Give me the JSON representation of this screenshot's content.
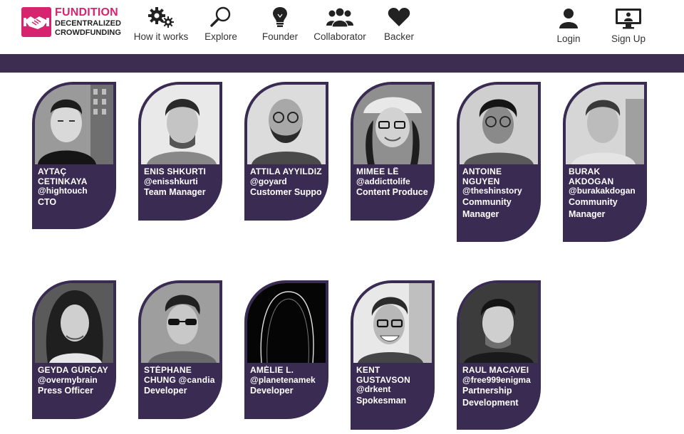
{
  "brand": {
    "title": "FUNDITION",
    "line1": "DECENTRALIZED",
    "line2": "CROWDFUNDING",
    "color": "#d6246e"
  },
  "nav": [
    {
      "label": "How it works",
      "icon": "gears-icon"
    },
    {
      "label": "Explore",
      "icon": "magnifier-icon"
    },
    {
      "label": "Founder",
      "icon": "lightbulb-icon"
    },
    {
      "label": "Collaborator",
      "icon": "group-icon"
    },
    {
      "label": "Backer",
      "icon": "heart-icon"
    }
  ],
  "auth": {
    "login": "Login",
    "signup": "Sign Up"
  },
  "team": [
    {
      "name1": "AYTAÇ",
      "name2": "CETINKAYA",
      "handle": "@hightouch",
      "role": "CTO"
    },
    {
      "name1": "ENIS SHKURTI",
      "handle": "@enisshkurti",
      "role": "Team Manager"
    },
    {
      "name1": "ATTILA AYYILDIZ",
      "handle": "@goyard",
      "role": "Customer Suppo"
    },
    {
      "name1": "MIMEE LÊ",
      "handle": "@addicttolife",
      "role": "Content Produce"
    },
    {
      "name1": "ANTOINE",
      "name2": "NGUYEN",
      "handle": "@theshinstory",
      "role": "Community Manager"
    },
    {
      "name1": "BURAK",
      "name2": "AKDOGAN",
      "handle": "@burakakdogan",
      "role": "Community Manager"
    },
    {
      "name1": "GEYDA GÜRCAY",
      "handle": "@overmybrain",
      "role": "Press Officer"
    },
    {
      "name1": "STÉPHANE",
      "name2": "CHUNG @candia",
      "role": "Developer"
    },
    {
      "name1": "AMÉLIE L.",
      "handle": "@planetenamek",
      "role": "Developer"
    },
    {
      "name1": "KENT",
      "name2": "GUSTAVSON",
      "handle": "@drkent",
      "role": "Spokesman"
    },
    {
      "name1": "RAUL MACAVEI",
      "handle": "@free999enigma",
      "role": "Partnership Development"
    }
  ],
  "colors": {
    "band": "#3d2d51",
    "card": "#3a2b52"
  }
}
